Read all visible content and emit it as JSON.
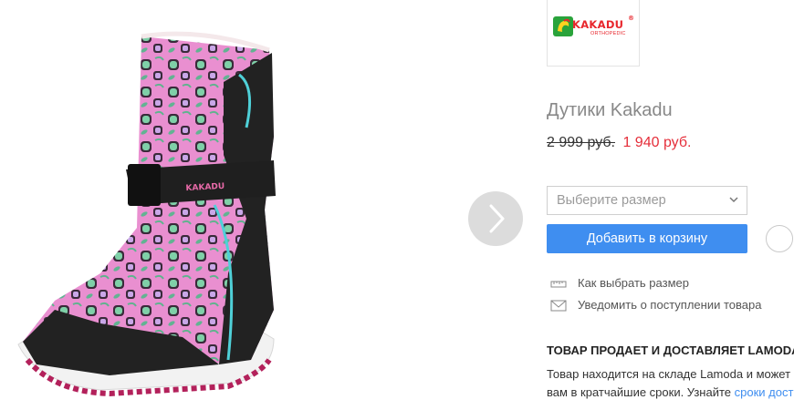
{
  "brand": {
    "logo_word": "KAKADU",
    "logo_sub": "ORTHOPEDIC",
    "registered_mark": "®"
  },
  "product": {
    "title": "Дутики Kakadu",
    "old_price": "2 999 руб.",
    "new_price": "1 940 руб.",
    "image_brand_print": "KAKADU"
  },
  "size_select": {
    "placeholder": "Выберите размер"
  },
  "actions": {
    "add_to_cart": "Добавить в корзину"
  },
  "help_links": {
    "size_guide": "Как выбрать размер",
    "notify": "Уведомить о поступлении товара"
  },
  "seller": {
    "heading": "ТОВАР ПРОДАЕТ И ДОСТАВЛЯЕТ LAMODA",
    "line1": "Товар находится на складе Lamoda и может",
    "line2_prefix": "вам в кратчайшие сроки. Узнайте ",
    "line2_link": "сроки дост"
  },
  "colors": {
    "accent_blue": "#3f8ef0",
    "sale_red": "#e52e3a",
    "brand_red": "#e8262c",
    "brand_green": "#2aa33b"
  },
  "icons": {
    "next": "chevron-right-icon",
    "select": "chevron-down-icon",
    "size_guide": "ruler-icon",
    "notify": "envelope-icon",
    "favorite": "heart-icon"
  }
}
